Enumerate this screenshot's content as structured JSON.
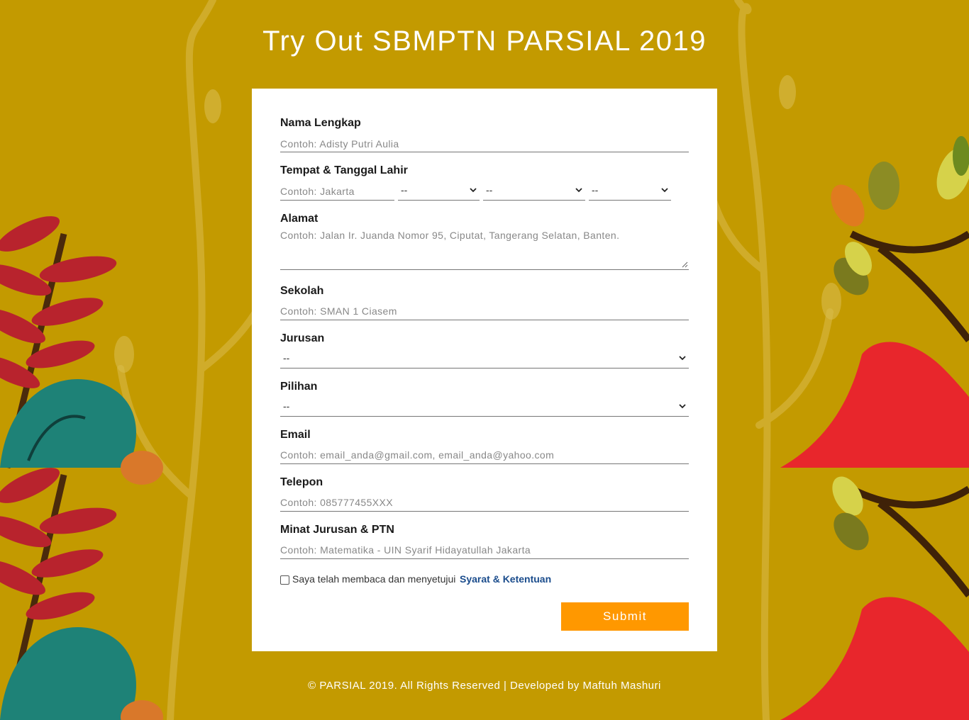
{
  "header": {
    "title": "Try Out SBMPTN PARSIAL 2019"
  },
  "colors": {
    "background": "#c39a00",
    "accent": "#ff9800",
    "link": "#1a4c8c"
  },
  "form": {
    "nama": {
      "label": "Nama Lengkap",
      "placeholder": "Contoh: Adisty Putri Aulia"
    },
    "ttl": {
      "label": "Tempat & Tanggal Lahir",
      "tempat_placeholder": "Contoh: Jakarta",
      "tanggal": "--",
      "bulan": "--",
      "tahun": "--"
    },
    "alamat": {
      "label": "Alamat",
      "placeholder": "Contoh: Jalan Ir. Juanda Nomor 95, Ciputat, Tangerang Selatan, Banten."
    },
    "sekolah": {
      "label": "Sekolah",
      "placeholder": "Contoh: SMAN 1 Ciasem"
    },
    "jurusan": {
      "label": "Jurusan",
      "value": "--"
    },
    "pilihan": {
      "label": "Pilihan",
      "value": "--"
    },
    "email": {
      "label": "Email",
      "placeholder": "Contoh: email_anda@gmail.com, email_anda@yahoo.com"
    },
    "telepon": {
      "label": "Telepon",
      "placeholder": "Contoh: 085777455XXX"
    },
    "minat": {
      "label": "Minat Jurusan & PTN",
      "placeholder": "Contoh: Matematika - UIN Syarif Hidayatullah Jakarta"
    },
    "agreement": {
      "text": "Saya telah membaca dan menyetujui",
      "link": "Syarat & Ketentuan",
      "checked": false
    },
    "submit_label": "Submit"
  },
  "footer": {
    "text": "© PARSIAL 2019. All Rights Reserved | Developed by Maftuh Mashuri"
  }
}
